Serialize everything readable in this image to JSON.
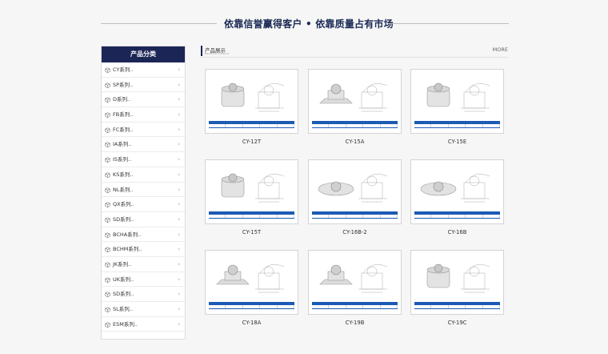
{
  "slogan": "依靠信誉赢得客户 • 依靠质量占有市场",
  "sidebar": {
    "title": "产品分类",
    "items": [
      {
        "label": "CY系列.."
      },
      {
        "label": "SP系列.."
      },
      {
        "label": "D系列.."
      },
      {
        "label": "FB系列.."
      },
      {
        "label": "FC系列.."
      },
      {
        "label": "IA系列.."
      },
      {
        "label": "IS系列.."
      },
      {
        "label": "KS系列.."
      },
      {
        "label": "NL系列.."
      },
      {
        "label": "QX系列.."
      },
      {
        "label": "SD系列.."
      },
      {
        "label": "BCHA系列.."
      },
      {
        "label": "BCHM系列.."
      },
      {
        "label": "JK系列.."
      },
      {
        "label": "UK系列.."
      },
      {
        "label": "SD系列.."
      },
      {
        "label": "SL系列.."
      },
      {
        "label": "ESM系列.."
      }
    ]
  },
  "section": {
    "title": "产品展示",
    "subtitle": "PRODUCT DISPLAY",
    "more": "MORE"
  },
  "products": [
    {
      "name": "CY-12T"
    },
    {
      "name": "CY-15A"
    },
    {
      "name": "CY-15E"
    },
    {
      "name": "CY-15T"
    },
    {
      "name": "CY-16B-2"
    },
    {
      "name": "CY-16B"
    },
    {
      "name": "CY-18A"
    },
    {
      "name": "CY-19B"
    },
    {
      "name": "CY-19C"
    }
  ],
  "colors": {
    "navy": "#1c2656",
    "spec_blue": "#1c5bb5"
  },
  "icons": {
    "sidebar_item": "cube-icon",
    "arrow": "chevron-right-icon"
  }
}
